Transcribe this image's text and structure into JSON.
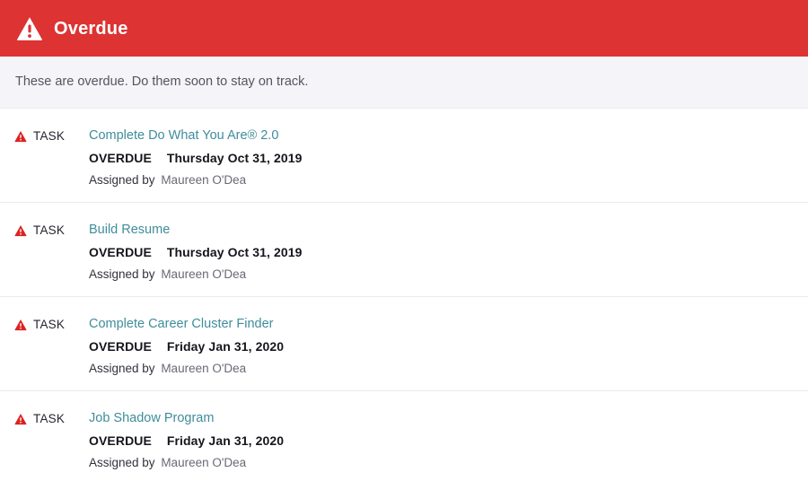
{
  "header": {
    "title": "Overdue",
    "icon": "warning-triangle-icon",
    "background_color": "#dd3333",
    "text_color": "#ffffff"
  },
  "subtitle": {
    "text": "These are overdue. Do them soon to stay on track.",
    "background_color": "#f5f4f8",
    "text_color": "#555561"
  },
  "colors": {
    "accent_red": "#dd3333",
    "link_teal": "#3f8d9b",
    "divider": "#eceaf2",
    "body_text": "#33313d"
  },
  "labels": {
    "assigned_by_prefix": "Assigned by",
    "task_type": "TASK",
    "overdue_status": "OVERDUE"
  },
  "tasks": [
    {
      "type": "TASK",
      "icon": "warning-triangle-icon",
      "title": "Complete Do What You Are® 2.0",
      "status": "OVERDUE",
      "due_date": "Thursday Oct 31, 2019",
      "assigned_prefix": "Assigned by",
      "assigned_by": "Maureen O'Dea"
    },
    {
      "type": "TASK",
      "icon": "warning-triangle-icon",
      "title": "Build Resume",
      "status": "OVERDUE",
      "due_date": "Thursday Oct 31, 2019",
      "assigned_prefix": "Assigned by",
      "assigned_by": "Maureen O'Dea"
    },
    {
      "type": "TASK",
      "icon": "warning-triangle-icon",
      "title": "Complete Career Cluster Finder",
      "status": "OVERDUE",
      "due_date": "Friday Jan 31, 2020",
      "assigned_prefix": "Assigned by",
      "assigned_by": "Maureen O'Dea"
    },
    {
      "type": "TASK",
      "icon": "warning-triangle-icon",
      "title": "Job Shadow Program",
      "status": "OVERDUE",
      "due_date": "Friday Jan 31, 2020",
      "assigned_prefix": "Assigned by",
      "assigned_by": "Maureen O'Dea"
    }
  ]
}
